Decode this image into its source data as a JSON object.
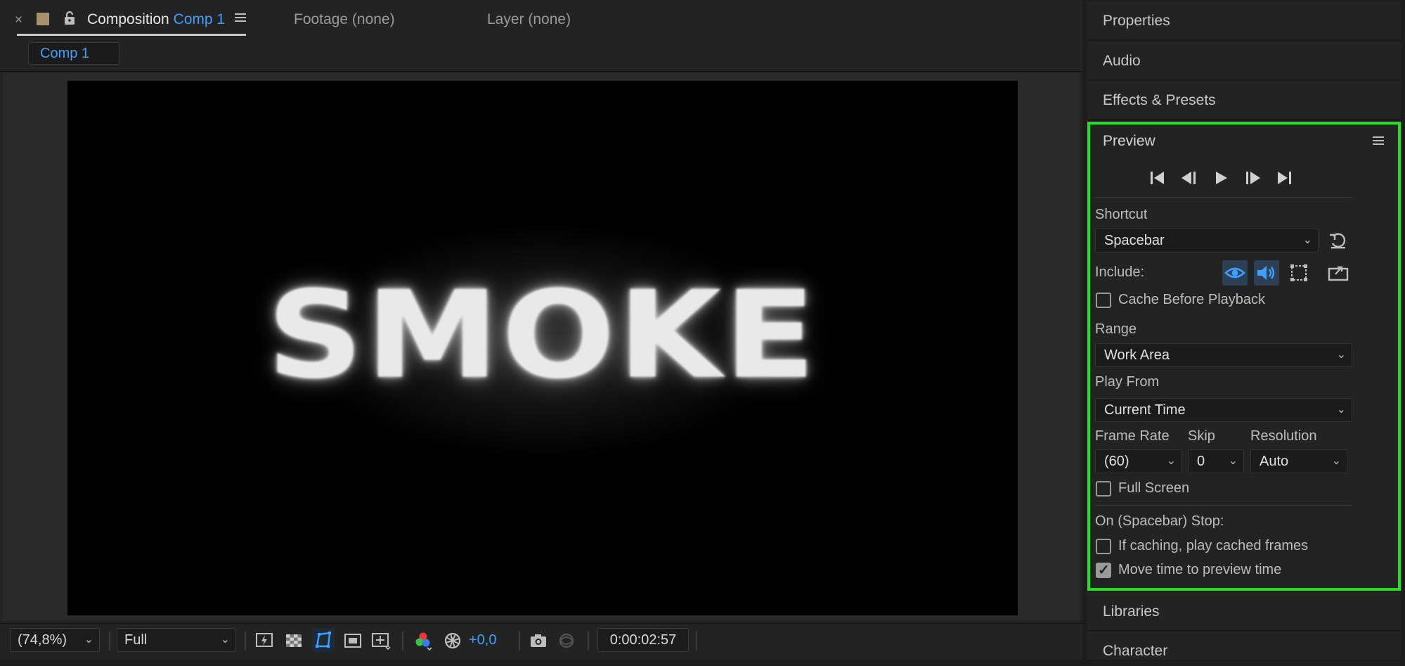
{
  "composition_panel": {
    "tab_title": "Composition",
    "tab_comp_name": "Comp 1",
    "footage_tab": "Footage (none)",
    "layer_tab": "Layer (none)",
    "subtab": "Comp 1",
    "canvas_text": "SMOKE"
  },
  "bottom_toolbar": {
    "zoom": "(74,8%)",
    "resolution": "Full",
    "exposure": "+0,0",
    "timecode": "0:00:02:57"
  },
  "right_panel": {
    "headers_top": [
      "Properties",
      "Audio",
      "Effects & Presets"
    ],
    "headers_bottom": [
      "Libraries",
      "Character"
    ],
    "preview": {
      "title": "Preview",
      "shortcut_label": "Shortcut",
      "shortcut_value": "Spacebar",
      "include_label": "Include:",
      "cache_before_playback": "Cache Before Playback",
      "cache_before_playback_checked": false,
      "range_label": "Range",
      "range_value": "Work Area",
      "play_from_label": "Play From",
      "play_from_value": "Current Time",
      "frame_rate_label": "Frame Rate",
      "frame_rate_value": "(60)",
      "skip_label": "Skip",
      "skip_value": "0",
      "resolution_label": "Resolution",
      "resolution_value": "Auto",
      "full_screen": "Full Screen",
      "full_screen_checked": false,
      "stop_label": "On (Spacebar) Stop:",
      "if_caching": "If caching, play cached frames",
      "if_caching_checked": false,
      "move_time": "Move time to preview time",
      "move_time_checked": true
    }
  },
  "colors": {
    "accent_blue": "#3ea0ff",
    "highlight_green": "#23e023",
    "label_swatch": "#a8916e"
  }
}
